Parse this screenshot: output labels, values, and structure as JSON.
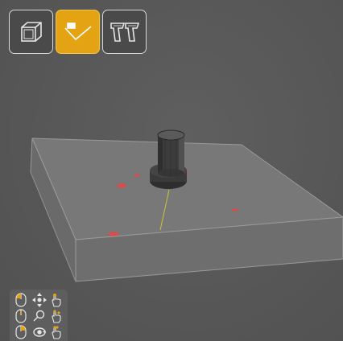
{
  "toolbar": {
    "buttons": [
      {
        "name": "3d-view",
        "icon": "cube-outline-icon",
        "active": false
      },
      {
        "name": "select-tool",
        "icon": "select-check-icon",
        "active": true
      },
      {
        "name": "support-tool",
        "icon": "support-pillars-icon",
        "active": false
      }
    ]
  },
  "colors": {
    "background": "#585858",
    "active_accent": "#e3a313",
    "button_border": "#d8d8d8",
    "build_plate": "#737373",
    "model": "#3a3a3a",
    "axis_line": "#c9c43a",
    "marker_red": "#ff3b3b"
  },
  "mouse_controls": {
    "rows": [
      {
        "mouse": "left-click-mouse-icon",
        "action": "move-arrows-icon",
        "gesture": "one-finger-drag-hand-icon"
      },
      {
        "mouse": "scroll-mouse-icon",
        "action": "zoom-magnifier-icon",
        "gesture": "pinch-hand-icon"
      },
      {
        "mouse": "right-click-mouse-icon",
        "action": "rotate-orbit-icon",
        "gesture": "two-finger-drag-hand-icon"
      }
    ]
  }
}
